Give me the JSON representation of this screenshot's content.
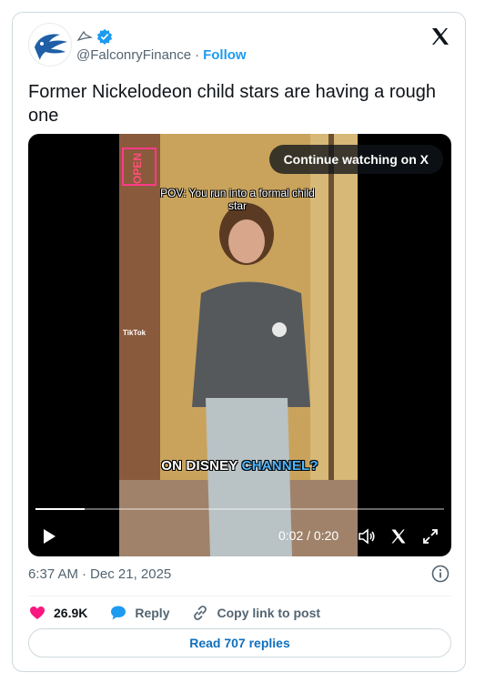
{
  "author": {
    "handle": "@FalconryFinance",
    "separator": "·",
    "follow_label": "Follow",
    "verified_color": "#1d9bf0"
  },
  "tweet": {
    "text": "Former Nickelodeon child stars are having a rough one"
  },
  "video": {
    "continue_label": "Continue watching on X",
    "overlay_top": "POV: You run into a formal child star",
    "overlay_bottom_prefix": "ON DISNEY ",
    "overlay_bottom_accent": "CHANNEL?",
    "sign_text": "OPEN",
    "watermark": "TikTok",
    "time": "0:02 / 0:20",
    "progress": 0.12
  },
  "meta": {
    "time": "6:37 AM",
    "separator": "·",
    "date": "Dec 21, 2025"
  },
  "actions": {
    "likes": "26.9K",
    "reply_label": "Reply",
    "copy_label": "Copy link to post",
    "like_color": "#f91880",
    "reply_color": "#1d9bf0"
  },
  "read_replies_label": "Read 707 replies",
  "icons": [
    "falcon-logo-icon",
    "verified-badge-icon",
    "bird-icon",
    "x-logo-icon",
    "play-icon",
    "volume-icon",
    "x-share-icon",
    "expand-icon",
    "info-icon",
    "heart-icon",
    "reply-icon",
    "link-icon"
  ]
}
